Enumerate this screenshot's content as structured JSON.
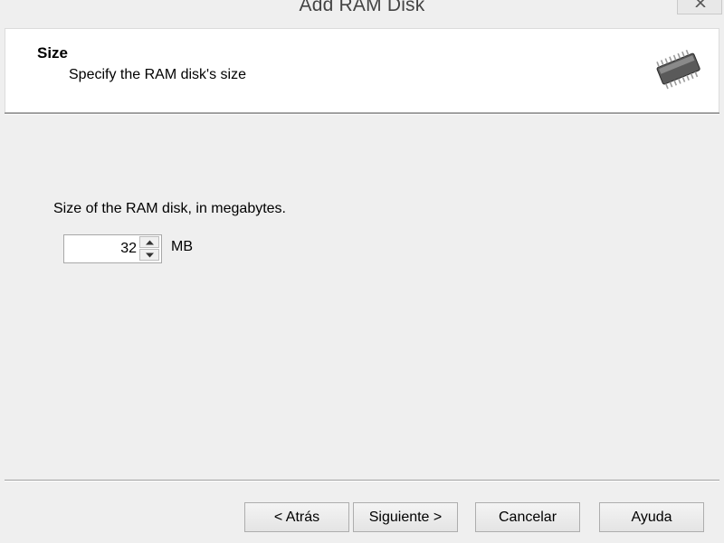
{
  "window": {
    "title": "Add RAM Disk"
  },
  "header": {
    "title": "Size",
    "subtitle": "Specify the RAM disk's size",
    "icon": "ram-chip-icon"
  },
  "body": {
    "size_label": "Size of the RAM disk, in megabytes.",
    "size_value": "32",
    "unit": "MB"
  },
  "buttons": {
    "back": "< Atrás",
    "next": "Siguiente >",
    "cancel": "Cancelar",
    "help": "Ayuda"
  }
}
